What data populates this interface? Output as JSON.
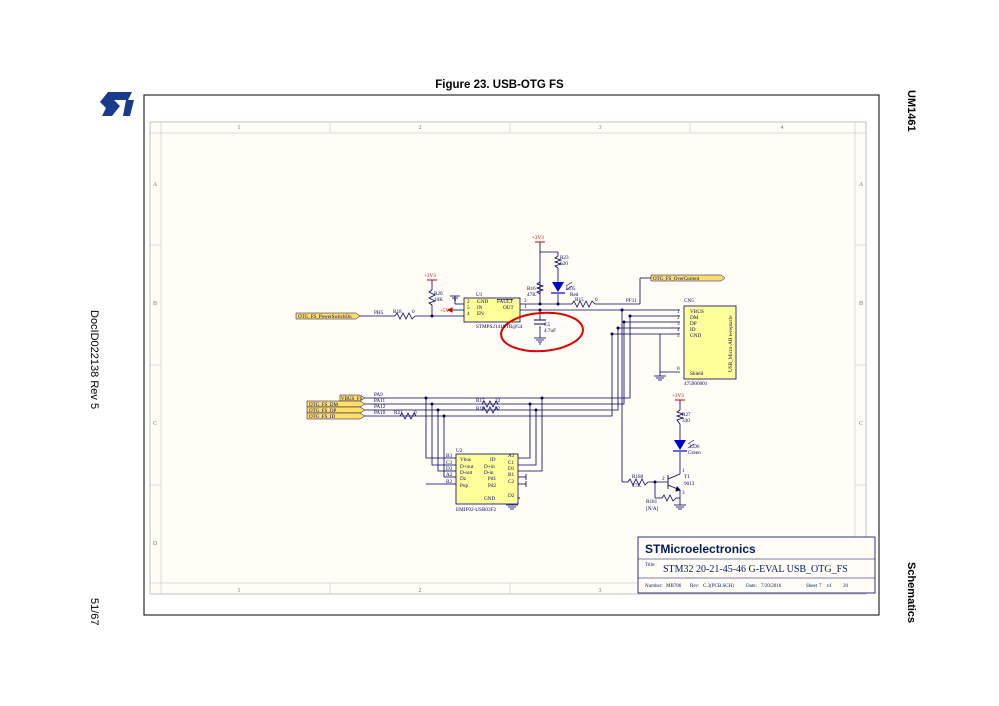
{
  "figure_title": "Figure 23. USB-OTG FS",
  "side_labels": {
    "doc_code": "UM1461",
    "section": "Schematics",
    "doc_id": "DocID022138 Rev 5",
    "page": "51/67"
  },
  "logo_text": "ST",
  "frame": {
    "columns": [
      "1",
      "2",
      "3",
      "4"
    ],
    "rows": [
      "A",
      "B",
      "C",
      "D"
    ]
  },
  "nets": {
    "power_switch_on": "OTG_FS_PowerSwitchOn",
    "over_current": "OTG_FS_OverCurrent",
    "vbus": "VBUS_FS",
    "dm": "OTG_FS_DM",
    "dp": "OTG_FS_DP",
    "id": "OTG_FS_ID"
  },
  "pins": {
    "ph5": "PH5",
    "pf11": "PF11",
    "pa9": "PA9",
    "pa11": "PA11",
    "pa12": "PA12",
    "pa10": "PA10"
  },
  "power": {
    "v33": "+3V3",
    "v5": "+5V"
  },
  "components": {
    "u1": {
      "ref": "U1",
      "part": "STMPS2141STR@54",
      "pins": [
        "GND",
        "IN",
        "EN",
        "FAULT",
        "OUT"
      ],
      "nums": [
        "2",
        "5",
        "4",
        "3",
        "1"
      ]
    },
    "r20": {
      "ref": "R20",
      "value": "10K"
    },
    "r18": {
      "ref": "R18",
      "value": "0"
    },
    "r23": {
      "ref": "R23",
      "value": "620"
    },
    "r16": {
      "ref": "R16",
      "value": "47K"
    },
    "ld5": {
      "ref": "LD5",
      "value": "Red"
    },
    "r15": {
      "ref": "R15",
      "value": "0"
    },
    "c5": {
      "ref": "C5",
      "value": "4.7uF"
    },
    "cn5": {
      "ref": "CN5",
      "part": "475900001",
      "desc": "USB_Micro-AB receptacle",
      "pins": [
        "VBUS",
        "DM",
        "DP",
        "ID",
        "GND",
        "Shield"
      ],
      "nums": [
        "1",
        "2",
        "3",
        "4",
        "5",
        "0"
      ]
    },
    "r17": {
      "ref": "R17",
      "value": "22"
    },
    "r19": {
      "ref": "R19",
      "value": "22"
    },
    "r21": {
      "ref": "R21",
      "value": "0"
    },
    "u2": {
      "ref": "U2",
      "part": "EMIF02-USB03F2",
      "left_pins": [
        "Vbus",
        "D+out",
        "D-out",
        "Dz",
        "Pup"
      ],
      "left_nums": [
        "B3",
        "C3",
        "D3",
        "A2",
        "B2"
      ],
      "right_pins": [
        "ID",
        "D+in",
        "D-in",
        "Pd1",
        "Pd2",
        "GND"
      ],
      "right_nums": [
        "A3",
        "C1",
        "D1",
        "B1",
        "C2",
        "D2"
      ]
    },
    "r27": {
      "ref": "R27",
      "value": "330"
    },
    "ld6": {
      "ref": "LD6",
      "value": "Green"
    },
    "r180": {
      "ref": "R180",
      "value": "47K"
    },
    "r181": {
      "ref": "R181",
      "value": "[N/A]"
    },
    "t1": {
      "ref": "T1",
      "value": "9013",
      "pins": [
        "2",
        "1",
        "3"
      ]
    }
  },
  "title_block": {
    "company": "STMicroelectronics",
    "title_label": "Title:",
    "title": "STM32 20-21-45-46 G-EVAL USB_OTG_FS",
    "number_label": "Number:",
    "number": "MB786",
    "rev_label": "Rev:",
    "rev": "C.3(PCB.SCH)",
    "date_label": "Date:",
    "date": "7/20/2016",
    "sheet_label": "Sheet",
    "sheet": "7",
    "of_label": "of",
    "sheets": "20"
  },
  "colors": {
    "wire": "#000066",
    "symbol_fill": "#ffff99",
    "net_label_fill": "#ffe066",
    "power_red": "#cc0000",
    "highlight_circle": "#e00000",
    "led_blue": "#0000cc",
    "title_text": "#001a66",
    "frame_bg": "#fffdf5"
  }
}
